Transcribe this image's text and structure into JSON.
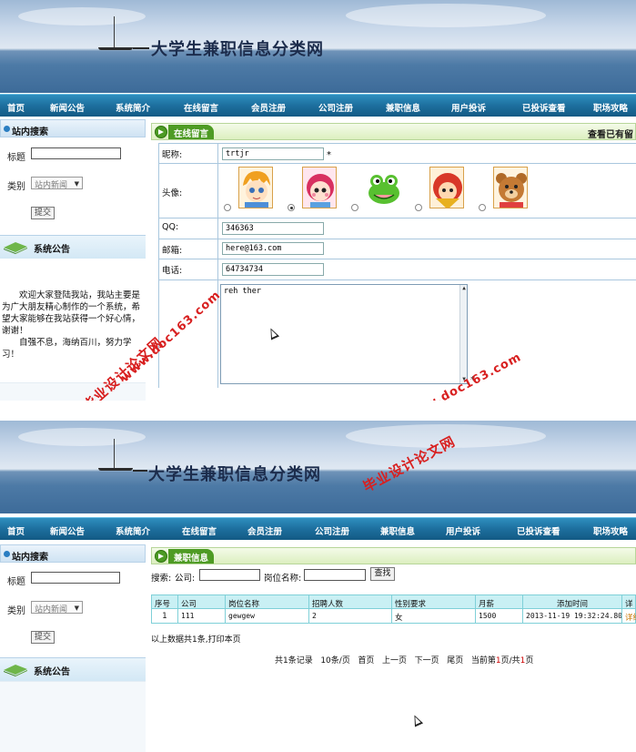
{
  "site": {
    "title": "大学生兼职信息分类网"
  },
  "nav": [
    "首页",
    "新闻公告",
    "系统简介",
    "在线留言",
    "会员注册",
    "公司注册",
    "兼职信息",
    "用户投诉",
    "已投诉查看",
    "职场攻略"
  ],
  "sidebar": {
    "search_title": "站内搜索",
    "title_label": "标题",
    "category_label": "类别",
    "category_value": "站内新闻",
    "submit_label": "提交",
    "notice_title": "系统公告",
    "notice_text": "欢迎大家登陆我站，我站主要是为广大朋友精心制作的一个系统，希望大家能够在我站获得一个好心情，谢谢！",
    "motto": "自强不息，海纳百川，努力学习！"
  },
  "message_form": {
    "tab": "在线留言",
    "right_link": "查看已有留",
    "nickname_label": "昵称:",
    "nickname_value": "trtjr",
    "avatar_label": "头像:",
    "avatars": [
      "boy-avatar-icon",
      "girl-avatar-icon",
      "frog-avatar-icon",
      "girl-hood-avatar-icon",
      "bear-avatar-icon"
    ],
    "avatar_selected_index": 1,
    "qq_label": "QQ:",
    "qq_value": "346363",
    "email_label": "邮箱:",
    "email_value": "here@163.com",
    "phone_label": "电话:",
    "phone_value": "64734734",
    "content_value": "reh ther",
    "required_mark": "*"
  },
  "watermarks": [
    "毕业设计论文网",
    "www.doc163.com"
  ],
  "jobs_page": {
    "tab": "兼职信息",
    "search_prefix": "搜索:",
    "company_label": "公司:",
    "position_label": "岗位名称:",
    "search_button": "查找",
    "columns": [
      "序号",
      "公司",
      "岗位名称",
      "招聘人数",
      "性别要求",
      "月薪",
      "添加时间",
      "详"
    ],
    "rows": [
      [
        "1",
        "111",
        "gewgew",
        "2",
        "女",
        "1500",
        "2013-11-19 19:32:24.803",
        "详细"
      ]
    ],
    "summary": "以上数据共1条,打印本页",
    "pager": {
      "total": "共1条记录",
      "per_page": "10条/页",
      "first": "首页",
      "prev": "上一页",
      "next": "下一页",
      "last": "尾页",
      "current_prefix": "当前第",
      "current_page": "1",
      "current_mid": "页/共",
      "total_pages": "1",
      "current_suffix": "页"
    }
  }
}
